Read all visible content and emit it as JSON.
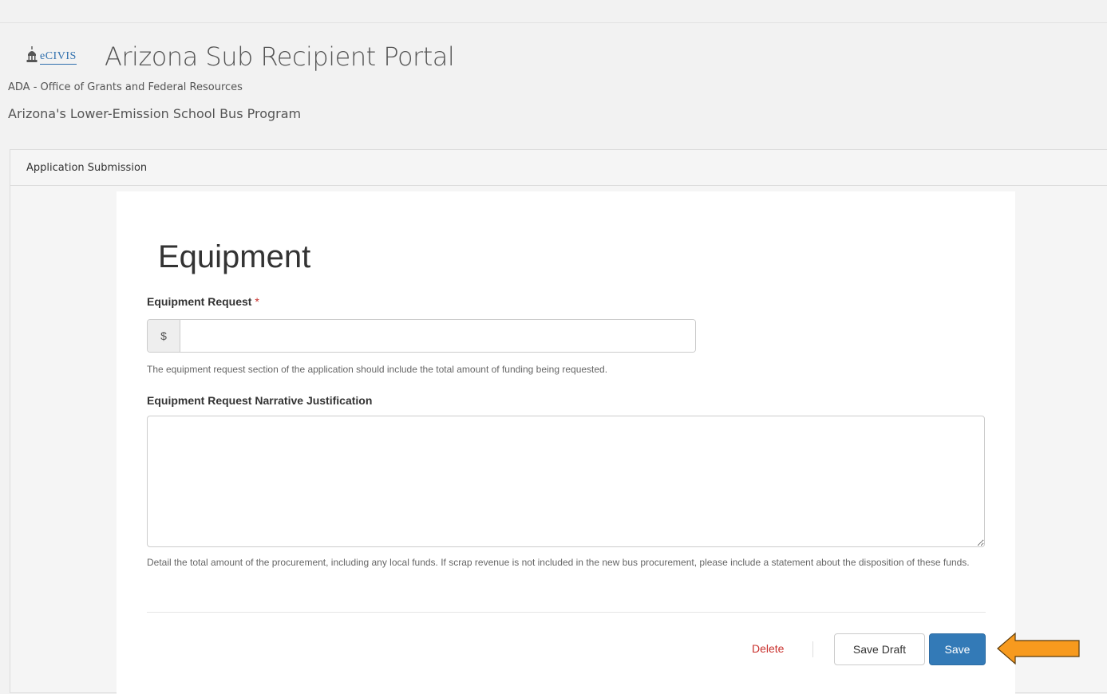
{
  "header": {
    "logo_text": "eCIVIS",
    "portal_title": "Arizona Sub Recipient Portal",
    "org_name": "ADA - Office of Grants and Federal Resources",
    "program_name": "Arizona's Lower-Emission School Bus Program"
  },
  "panel": {
    "heading": "Application Submission"
  },
  "form": {
    "title": "Equipment",
    "equipment_request": {
      "label": "Equipment Request",
      "required_mark": "*",
      "currency_symbol": "$",
      "value": "",
      "help": "The equipment request section of the application should include the total amount of funding being requested."
    },
    "narrative": {
      "label": "Equipment Request Narrative Justification",
      "value": "",
      "help": "Detail the total amount of the procurement, including any local funds. If scrap revenue is not included in the new bus procurement, please include a statement about the disposition of these funds."
    },
    "actions": {
      "delete_label": "Delete",
      "save_draft_label": "Save Draft",
      "save_label": "Save"
    }
  },
  "colors": {
    "save_button": "#337ab7",
    "delete_text": "#c9302c",
    "annotation_arrow": "#f79a1e"
  },
  "icons": {
    "logo": "capitol-building-icon",
    "annotation": "left-arrow-icon"
  }
}
